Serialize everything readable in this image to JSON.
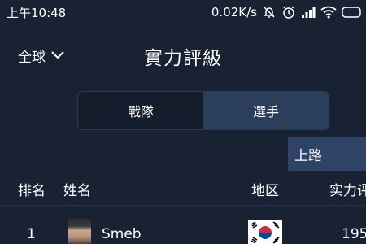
{
  "status_bar": {
    "time": "上午10:48",
    "network_speed": "0.02K/s"
  },
  "header": {
    "region": "全球",
    "title": "實力評級"
  },
  "tabs": [
    {
      "label": "戰隊",
      "active": false
    },
    {
      "label": "選手",
      "active": true
    }
  ],
  "position_dropdown": {
    "selected": "上路"
  },
  "table": {
    "columns": [
      "排名",
      "姓名",
      "地区",
      "实力评"
    ],
    "rows": [
      {
        "rank": "1",
        "name": "Smeb",
        "region_icon": "south-korea-flag-icon",
        "score": "195"
      }
    ]
  },
  "colors": {
    "background": "#182232",
    "active_tab": "#2b3e5c",
    "dropdown": "#2f4366"
  }
}
